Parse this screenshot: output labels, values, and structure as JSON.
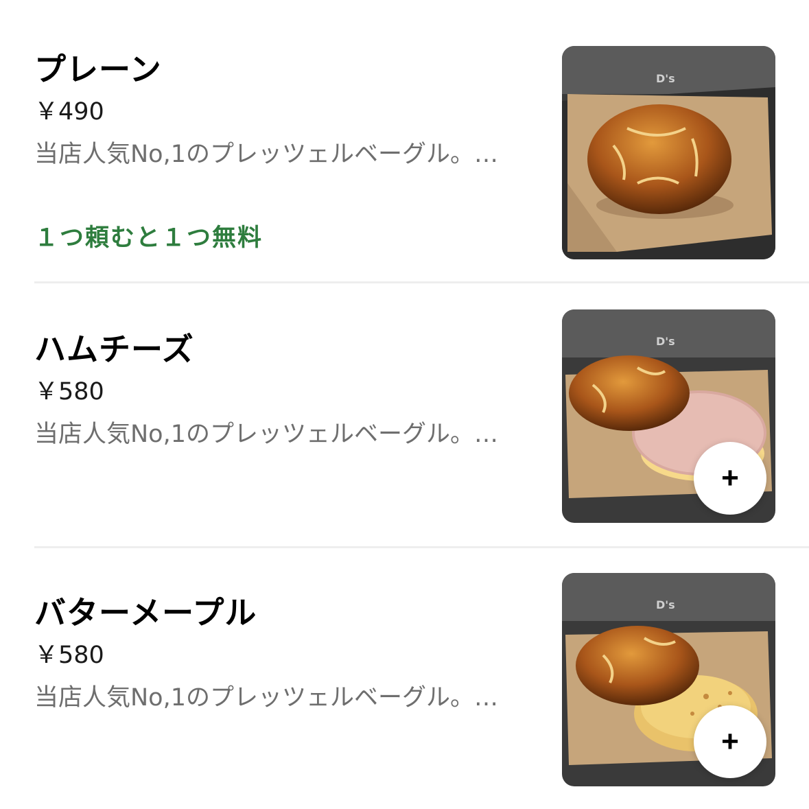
{
  "menu": {
    "items": [
      {
        "name": "プレーン",
        "price": "￥490",
        "description": "当店人気No,1のプレッツェルベーグル。…",
        "promo": "１つ頼むと１つ無料",
        "thumb_variant": "plain",
        "has_add_button": false
      },
      {
        "name": "ハムチーズ",
        "price": "￥580",
        "description": "当店人気No,1のプレッツェルベーグル。…",
        "promo": "",
        "thumb_variant": "ham-cheese",
        "has_add_button": true
      },
      {
        "name": "バターメープル",
        "price": "￥580",
        "description": "当店人気No,1のプレッツェルベーグル。…",
        "promo": "",
        "thumb_variant": "butter-maple",
        "has_add_button": true
      }
    ],
    "add_button_label": "+",
    "brand_mark": "D's"
  },
  "colors": {
    "promo": "#2e7d3e",
    "description": "#6e6e6e",
    "divider": "#eeeeee"
  },
  "icons": {
    "add": "plus-icon"
  }
}
